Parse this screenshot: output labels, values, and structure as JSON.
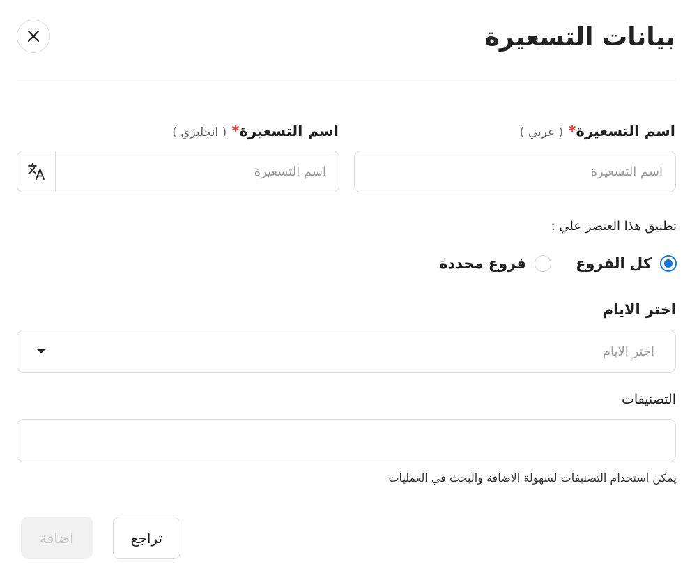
{
  "header": {
    "title": "بيانات التسعيرة",
    "close_icon": "close-icon"
  },
  "name_ar": {
    "label": "اسم التسعيرة",
    "required_mark": "*",
    "hint": "( عربي )",
    "placeholder": "اسم التسعيرة"
  },
  "name_en": {
    "label": "اسم التسعيرة",
    "required_mark": "*",
    "hint": "( انجليزي )",
    "placeholder": "اسم التسعيرة",
    "translate_icon": "translate-icon"
  },
  "apply": {
    "label": "تطبيق هذا العنصر علي :",
    "options": [
      {
        "label": "كل الفروع",
        "selected": true
      },
      {
        "label": "فروع محددة",
        "selected": false
      }
    ]
  },
  "days": {
    "label": "اختر الايام",
    "placeholder": "اختر الايام"
  },
  "tags": {
    "label": "التصنيفات",
    "value": "",
    "helper": "يمكن استخدام التصنيفات لسهولة الاضافة والبحث في العمليات"
  },
  "actions": {
    "back_label": "تراجع",
    "add_label": "اضافة"
  },
  "colors": {
    "accent": "#1976d2",
    "required": "#e53935",
    "disabled_bg": "#f1f1f1",
    "disabled_text": "#c2c2c2"
  }
}
